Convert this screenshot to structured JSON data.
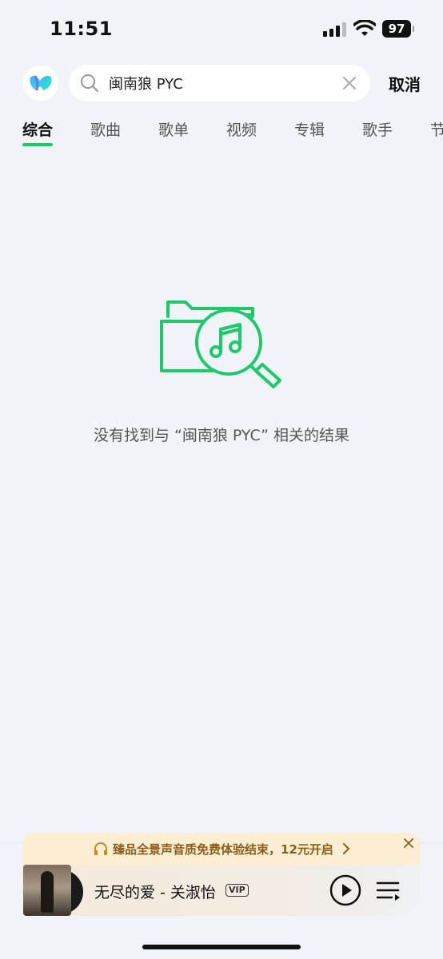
{
  "status_bar": {
    "time": "11:51",
    "battery": "97"
  },
  "search": {
    "query": "闽南狼 PYC",
    "cancel_label": "取消"
  },
  "tabs": [
    {
      "label": "综合",
      "active": true
    },
    {
      "label": "歌曲",
      "active": false
    },
    {
      "label": "歌单",
      "active": false
    },
    {
      "label": "视频",
      "active": false
    },
    {
      "label": "专辑",
      "active": false
    },
    {
      "label": "歌手",
      "active": false
    },
    {
      "label": "节",
      "active": false
    }
  ],
  "empty_state": {
    "message": "没有找到与 “闽南狼 PYC” 相关的结果",
    "icon": "folder-music-search-icon"
  },
  "promo": {
    "text": "臻品全景声音质免费体验结束，12元开启"
  },
  "player": {
    "song": "无尽的爱 - 关淑怡",
    "badge": "VIP"
  },
  "colors": {
    "accent": "#1ec96a",
    "background": "#f0f3f8",
    "promo_text": "#8b5e1a"
  }
}
